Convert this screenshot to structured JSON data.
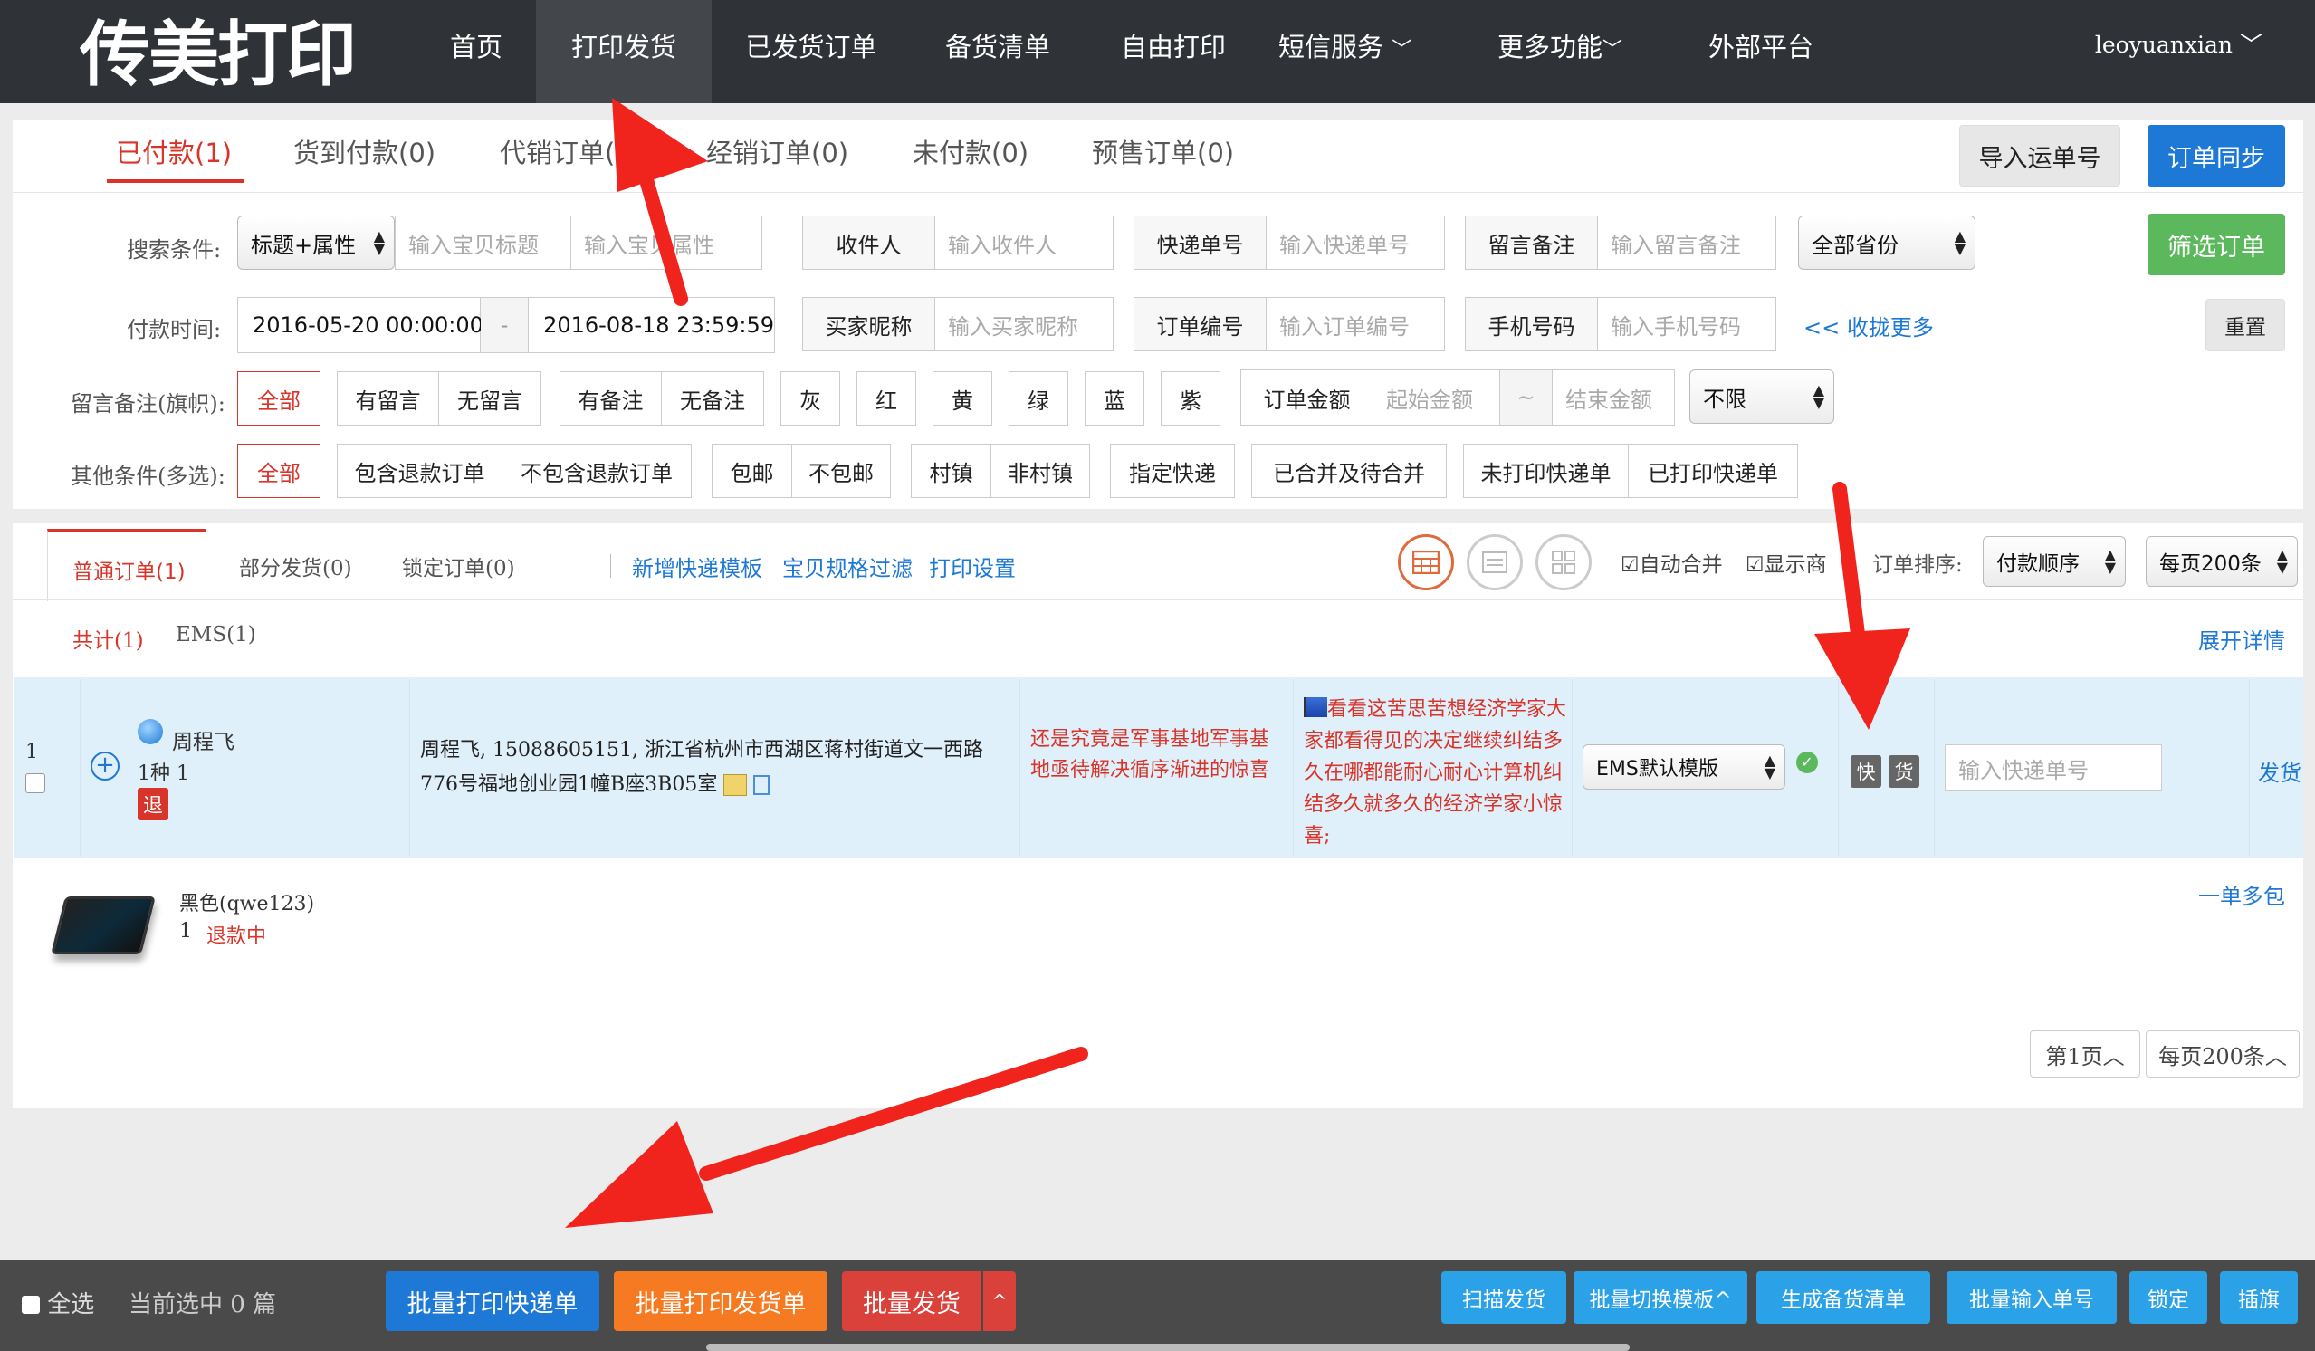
{
  "colors": {
    "nav_bg": "#2f3236",
    "accent_red": "#d8342a",
    "accent_blue": "#1d78d6",
    "green": "#5cb85c",
    "row_bg": "#e0f0fa",
    "bottom_bar": "#4a4a4a"
  },
  "nav": {
    "logo": "传美打印",
    "items": [
      "首页",
      "打印发货",
      "已发货订单",
      "备货清单",
      "自由打印",
      "短信服务",
      "更多功能",
      "外部平台"
    ],
    "active": "打印发货",
    "user": "leoyuanxian"
  },
  "tabs": {
    "items": [
      "已付款(1)",
      "货到付款(0)",
      "代销订单(0)",
      "经销订单(0)",
      "未付款(0)",
      "预售订单(0)"
    ],
    "import_btn": "导入运单号",
    "sync_btn": "订单同步"
  },
  "search": {
    "label_cond": "搜索条件:",
    "cond_select": "标题+属性",
    "ph_title": "输入宝贝标题",
    "ph_attr": "输入宝贝属性",
    "recipient_cap": "收件人",
    "recipient_ph": "输入收件人",
    "express_cap": "快递单号",
    "express_ph": "输入快递单号",
    "note_cap": "留言备注",
    "note_ph": "输入留言备注",
    "province": "全部省份",
    "filter_btn": "筛选订单",
    "label_time": "付款时间:",
    "time_from": "2016-05-20 00:00:00",
    "time_sep": "-",
    "time_to": "2016-08-18 23:59:59",
    "buyer_cap": "买家昵称",
    "buyer_ph": "输入买家昵称",
    "order_cap": "订单编号",
    "order_ph": "输入订单编号",
    "phone_cap": "手机号码",
    "phone_ph": "输入手机号码",
    "collapse": "<< 收拢更多",
    "reset_btn": "重置",
    "label_note": "留言备注(旗帜):",
    "note_all": "全部",
    "note_has_msg": "有留言",
    "note_no_msg": "无留言",
    "note_has_rem": "有备注",
    "note_no_rem": "无备注",
    "flags": [
      "灰",
      "红",
      "黄",
      "绿",
      "蓝",
      "紫"
    ],
    "amount_cap": "订单金额",
    "amount_from": "起始金额",
    "amount_sep": "~",
    "amount_to": "结束金额",
    "amount_limit": "不限",
    "label_other": "其他条件(多选):",
    "other_all": "全部",
    "other_opts": [
      [
        "包含退款订单",
        "不包含退款订单"
      ],
      [
        "包邮",
        "不包邮"
      ],
      [
        "村镇",
        "非村镇"
      ],
      [
        "指定快递"
      ],
      [
        "已合并及待合并"
      ],
      [
        "未打印快递单",
        "已打印快递单"
      ]
    ]
  },
  "orders": {
    "subtabs": [
      "普通订单(1)",
      "部分发货(0)",
      "锁定订单(0)"
    ],
    "links": [
      "新增快递模板",
      "宝贝规格过滤",
      "打印设置"
    ],
    "auto_merge": "自动合并",
    "show_merchant": "显示商",
    "sort_label": "订单排序:",
    "sort_value": "付款顺序",
    "per_page": "每页200条",
    "total": "共计(1)",
    "ems": "EMS(1)",
    "expand": "展开详情",
    "row": {
      "index": "1",
      "buyer": "周程飞",
      "qty": "1种 1",
      "refund_badge": "退",
      "address": "周程飞, 15088605151, 浙江省杭州市西湖区蒋村街道文一西路776号福地创业园1幢B座3B05室",
      "buyer_msg": "还是究竟是军事基地军事基地亟待解决循序渐进的惊喜",
      "seller_note": "看看这苦思苦想经济学家大家都看得见的决定继续纠结多久在哪都能耐心耐心计算机纠结多久就多久的经济学家小惊喜;",
      "template": "EMS默认模版",
      "tag1": "快",
      "tag2": "货",
      "express_ph": "输入快递单号",
      "ship": "发货",
      "item_name": "黑色(qwe123)",
      "item_qty": "1",
      "item_status": "退款中",
      "multi_pkg": "一单多包"
    },
    "page": "第1页",
    "page_size": "每页200条"
  },
  "bottom": {
    "select_all": "全选",
    "selected": "当前选中 0 篇",
    "btn_print_express": "批量打印快递单",
    "btn_print_invoice": "批量打印发货单",
    "btn_ship": "批量发货",
    "caret": "^",
    "right_btns": [
      "扫描发货",
      "批量切换模板^",
      "生成备货清单",
      "批量输入单号",
      "锁定",
      "插旗"
    ]
  }
}
